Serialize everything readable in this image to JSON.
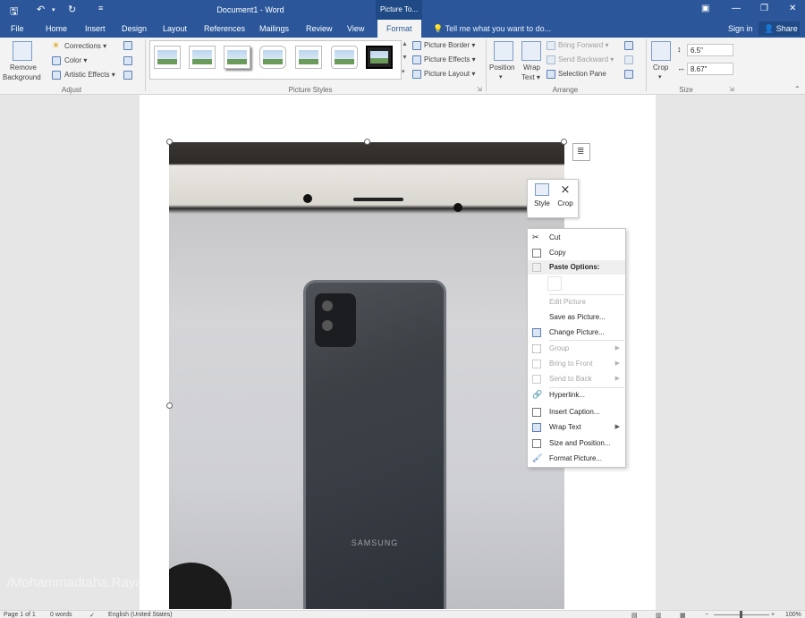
{
  "titlebar": {
    "doc_title": "Document1 - Word",
    "context_tab": "Picture To...",
    "colors": {
      "brand": "#2b579a"
    }
  },
  "tabs": {
    "items": [
      "File",
      "Home",
      "Insert",
      "Design",
      "Layout",
      "References",
      "Mailings",
      "Review",
      "View",
      "Format"
    ],
    "active": "Format",
    "tell_me": "Tell me what you want to do...",
    "sign_in": "Sign in",
    "share": "Share"
  },
  "ribbon": {
    "adjust": {
      "remove_background_line1": "Remove",
      "remove_background_line2": "Background",
      "corrections": "Corrections",
      "color": "Color",
      "artistic_effects": "Artistic Effects",
      "group_name": "Adjust"
    },
    "picture_styles": {
      "group_name": "Picture Styles",
      "picture_border": "Picture Border",
      "picture_effects": "Picture Effects",
      "picture_layout": "Picture Layout"
    },
    "arrange": {
      "position": "Position",
      "wrap_text_line1": "Wrap",
      "wrap_text_line2": "Text",
      "bring_forward": "Bring Forward",
      "send_backward": "Send Backward",
      "selection_pane": "Selection Pane",
      "group_name": "Arrange"
    },
    "size": {
      "crop": "Crop",
      "height": "6.5\"",
      "width": "8.67\"",
      "group_name": "Size"
    }
  },
  "photo": {
    "brand_text": "SAMSUNG"
  },
  "mini_toolbar": {
    "style": "Style",
    "crop": "Crop"
  },
  "context_menu": {
    "items": [
      {
        "label": "Cut",
        "disabled": false
      },
      {
        "label": "Copy",
        "disabled": false
      },
      {
        "label": "Paste Options:",
        "disabled": false
      },
      {
        "label": "Edit Picture",
        "disabled": true
      },
      {
        "label": "Save as Picture...",
        "disabled": false
      },
      {
        "label": "Change Picture...",
        "disabled": false
      },
      {
        "label": "Group",
        "disabled": true
      },
      {
        "label": "Bring to Front",
        "disabled": true
      },
      {
        "label": "Send to Back",
        "disabled": true
      },
      {
        "label": "Hyperlink...",
        "disabled": false
      },
      {
        "label": "Insert Caption...",
        "disabled": false
      },
      {
        "label": "Wrap Text",
        "disabled": false
      },
      {
        "label": "Size and Position...",
        "disabled": false
      },
      {
        "label": "Format Picture...",
        "disabled": false
      }
    ]
  },
  "watermark": "/Mohammadtaha.Rayatfard",
  "statusbar": {
    "page": "Page 1 of 1",
    "words": "0 words",
    "language": "English (United States)",
    "zoom": "100%"
  }
}
